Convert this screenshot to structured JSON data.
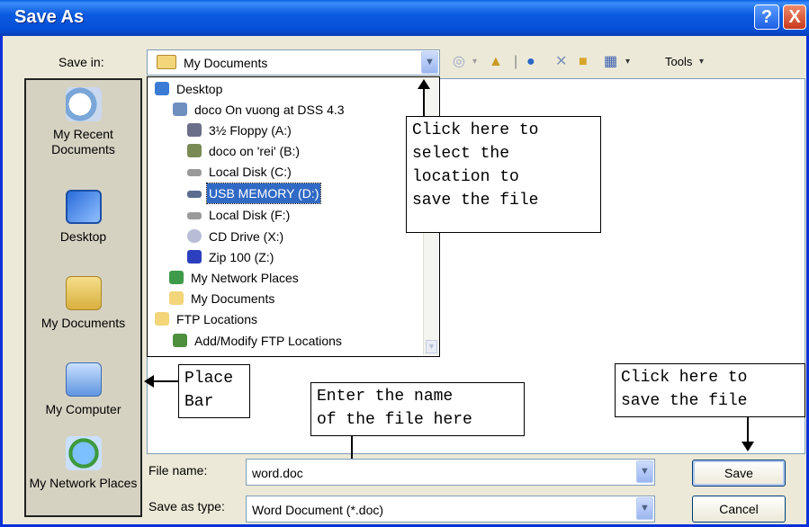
{
  "window": {
    "title": "Save As"
  },
  "title_buttons": {
    "help": "?",
    "close": "X"
  },
  "save_in": {
    "label": "Save in:",
    "value": "My Documents"
  },
  "toolbar": {
    "tools_label": "Tools"
  },
  "places": [
    {
      "label": "My Recent Documents"
    },
    {
      "label": "Desktop"
    },
    {
      "label": "My Documents"
    },
    {
      "label": "My Computer"
    },
    {
      "label": "My Network Places"
    }
  ],
  "dropdown_items": [
    {
      "label": "Desktop"
    },
    {
      "label": "doco On vuong at DSS 4.3"
    },
    {
      "label": "3½ Floppy (A:)"
    },
    {
      "label": "doco on 'rei' (B:)"
    },
    {
      "label": "Local Disk (C:)"
    },
    {
      "label": "USB MEMORY (D:)"
    },
    {
      "label": "Local Disk (F:)"
    },
    {
      "label": "CD Drive (X:)"
    },
    {
      "label": "Zip 100  (Z:)"
    },
    {
      "label": "My Network Places"
    },
    {
      "label": "My Documents"
    },
    {
      "label": "FTP Locations"
    },
    {
      "label": "Add/Modify FTP Locations"
    }
  ],
  "callouts": {
    "location": "Click here to\nselect the\nlocation to\nsave the file",
    "place_bar": "Place\nBar",
    "file_name": "Enter the name\nof the file here",
    "save": "Click here to\nsave the file"
  },
  "file_name": {
    "label": "File name:",
    "value": "word.doc"
  },
  "file_type": {
    "label": "Save as type:",
    "value": "Word Document (*.doc)"
  },
  "buttons": {
    "save": "Save",
    "cancel": "Cancel"
  },
  "icons": {
    "folder": "folder-icon",
    "network": "network-icon",
    "drive": "drive-icon",
    "floppy": "floppy-icon",
    "cd": "cd-icon",
    "zip": "zip-icon",
    "ftp": "ftp-icon"
  }
}
